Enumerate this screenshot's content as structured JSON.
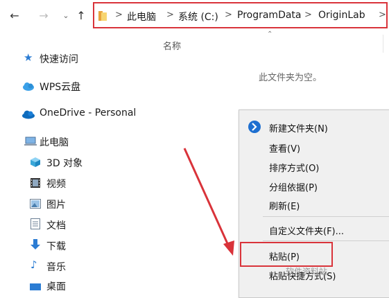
{
  "toolbar": {
    "back_icon": "arrow-left",
    "forward_icon": "arrow-right",
    "recent_icon": "chevron-down",
    "up_icon": "arrow-up"
  },
  "address": {
    "crumbs": [
      "此电脑",
      "系统 (C:)",
      "ProgramData",
      "OriginLab"
    ],
    "separator": ">"
  },
  "content": {
    "column_name": "名称",
    "empty_message": "此文件夹为空。"
  },
  "sidebar": {
    "items": [
      {
        "label": "快速访问",
        "icon": "star-icon"
      },
      {
        "label": "WPS云盘",
        "icon": "cloud-icon"
      },
      {
        "label": "OneDrive - Personal",
        "icon": "onedrive-icon"
      },
      {
        "label": "此电脑",
        "icon": "computer-icon"
      },
      {
        "label": "3D 对象",
        "icon": "cube-icon"
      },
      {
        "label": "视频",
        "icon": "film-icon"
      },
      {
        "label": "图片",
        "icon": "image-icon"
      },
      {
        "label": "文档",
        "icon": "document-icon"
      },
      {
        "label": "下载",
        "icon": "download-icon"
      },
      {
        "label": "音乐",
        "icon": "music-icon"
      },
      {
        "label": "桌面",
        "icon": "desktop-icon"
      }
    ]
  },
  "context_menu": {
    "items": [
      {
        "label": "新建文件夹(N)"
      },
      {
        "label": "查看(V)"
      },
      {
        "label": "排序方式(O)"
      },
      {
        "label": "分组依据(P)"
      },
      {
        "label": "刷新(E)"
      },
      {
        "label": "自定义文件夹(F)..."
      },
      {
        "label": "粘贴(P)"
      },
      {
        "label": "粘贴快捷方式(S)"
      }
    ]
  },
  "watermark": "软件资料站",
  "colors": {
    "highlight_red": "#d9333a",
    "accent_blue": "#1e6fd0"
  }
}
